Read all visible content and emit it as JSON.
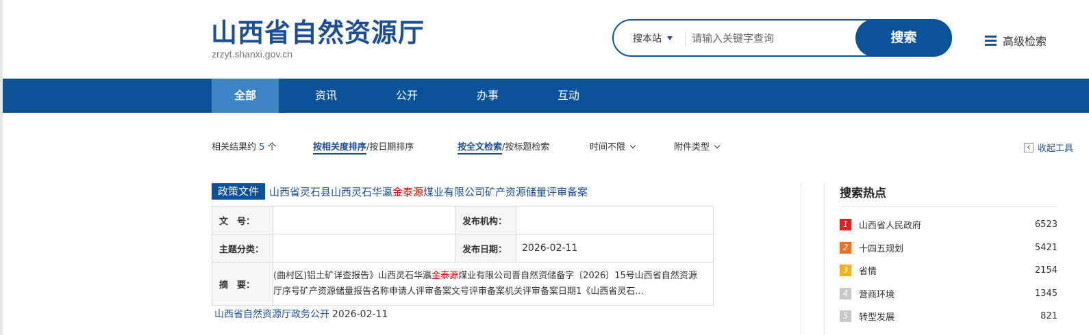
{
  "header": {
    "site_title": "山西省自然资源厅",
    "site_domain": "zrzyt.shanxi.gov.cn",
    "search_scope": "搜本站",
    "search_placeholder": "请输入关键字查询",
    "search_button": "搜索",
    "advanced_search": "高级检索"
  },
  "nav": {
    "items": [
      "全部",
      "资讯",
      "公开",
      "办事",
      "互动"
    ],
    "active": "全部"
  },
  "filters": {
    "result_prefix": "相关结果约",
    "result_count": "5",
    "result_suffix": "个",
    "sort_relevance": "按相关度排序",
    "sort_date": "/按日期排序",
    "search_fulltext": "按全文检索",
    "search_title": "/按标题检索",
    "time_filter": "时间不限",
    "attachment_filter": "附件类型",
    "collapse_tools": "收起工具"
  },
  "result": {
    "tag": "政策文件",
    "title_before": "山西省灵石县山西灵石华瀛",
    "title_highlight": "金泰源",
    "title_after": "煤业有限公司矿产资源储量评审备案",
    "labels": {
      "doc_no": "文　号：",
      "publisher": "发布机构：",
      "subject": "主题分类：",
      "publish_date": "发布日期：",
      "summary": "摘　要："
    },
    "doc_no": "",
    "publisher": "",
    "subject": "",
    "publish_date": "2026-02-11",
    "summary_before": "(曲村区)铝土矿详查报告》山西灵石华瀛",
    "summary_highlight": "金泰源",
    "summary_after": "煤业有限公司晋自然资储备字〔2026〕15号山西省自然资源厅序号矿产资源储量报告名称申请人评审备案文号评审备案机关评审备案日期1《山西省灵石...",
    "source": "山西省自然资源厅政务公开",
    "source_date": "2026-02-11"
  },
  "hot_searches": {
    "title": "搜索热点",
    "items": [
      {
        "rank": "1",
        "name": "山西省人民政府",
        "count": "6523",
        "color": "#e02020"
      },
      {
        "rank": "2",
        "name": "十四五规划",
        "count": "5421",
        "color": "#f07028"
      },
      {
        "rank": "3",
        "name": "省情",
        "count": "2154",
        "color": "#f0b020"
      },
      {
        "rank": "4",
        "name": "营商环境",
        "count": "1345",
        "color": "#c8c8c8"
      },
      {
        "rank": "5",
        "name": "转型发展",
        "count": "821",
        "color": "#c8c8c8"
      }
    ]
  },
  "colors": {
    "brand": "#0b5298",
    "nav_active": "#3d85c6",
    "highlight": "#ee0000"
  }
}
